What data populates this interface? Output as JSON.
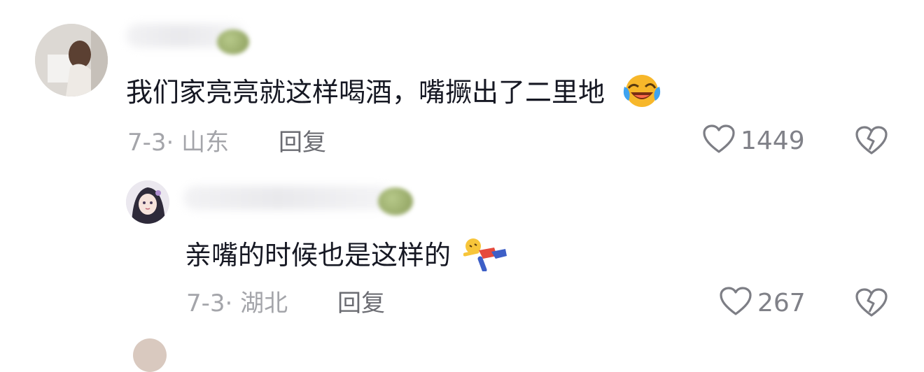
{
  "comments": [
    {
      "text": "我们家亮亮就这样喝酒，嘴撅出了二里地",
      "emoji": "laughing-tears-emoji",
      "date_location": "7-3· 山东",
      "reply_label": "回复",
      "likes": "1449"
    },
    {
      "text": "亲嘴的时候也是这样的",
      "emoji": "pushing-figure-emoji",
      "date_location": "7-3· 湖北",
      "reply_label": "回复",
      "likes": "267"
    }
  ],
  "colors": {
    "text": "#161823",
    "meta": "#a4a5aa",
    "reply": "#6b6c72",
    "like": "#808188",
    "icon": "#7d7e85"
  }
}
